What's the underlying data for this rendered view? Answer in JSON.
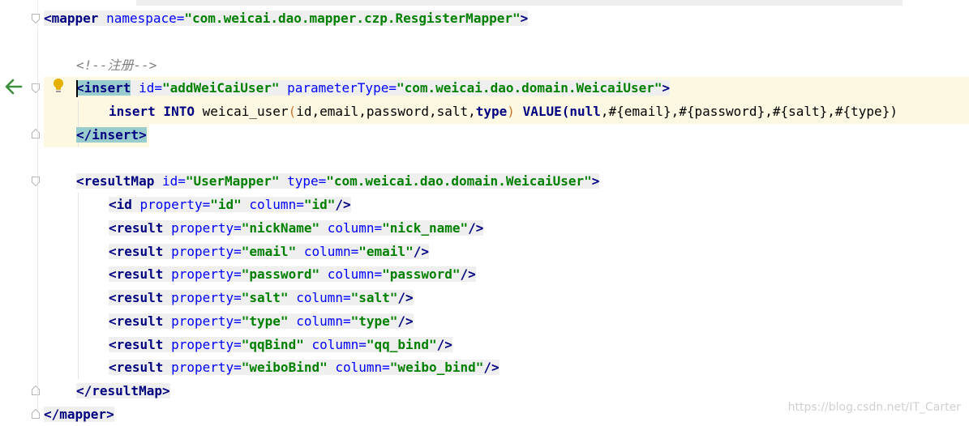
{
  "editor": {
    "lines": [
      {
        "id": "mapper_open",
        "text_parts": [
          {
            "t": "<mapper ",
            "c": "t"
          },
          {
            "t": "namespace=",
            "c": "a"
          },
          {
            "t": "\"",
            "c": "s"
          },
          {
            "t": "com.weicai.dao.mapper.czp.ResgisterMapper",
            "c": "s"
          },
          {
            "t": "\"",
            "c": "s"
          },
          {
            "t": ">",
            "c": "t"
          }
        ]
      },
      {
        "id": "comment",
        "text_parts": [
          {
            "t": "<!--注册-->",
            "c": "c"
          }
        ]
      },
      {
        "id": "insert_open",
        "text_parts": [
          {
            "t": "<insert",
            "c": "t match"
          },
          {
            "t": " id=",
            "c": "a"
          },
          {
            "t": "\"addWeiCaiUser\"",
            "c": "s"
          },
          {
            "t": " parameterType=",
            "c": "a"
          },
          {
            "t": "\"com.weicai.dao.domain.WeicaiUser\"",
            "c": "s"
          },
          {
            "t": ">",
            "c": "t"
          }
        ]
      },
      {
        "id": "insert_body",
        "text_parts": [
          {
            "t": "insert INTO ",
            "c": "kw"
          },
          {
            "t": "weicai_user",
            "c": "fn"
          },
          {
            "t": "(",
            "c": "paren"
          },
          {
            "t": "id,email,password,salt,",
            "c": "fn"
          },
          {
            "t": "type",
            "c": "kw"
          },
          {
            "t": ")",
            "c": "paren"
          },
          {
            "t": " VALUE(",
            "c": "kw"
          },
          {
            "t": "null",
            "c": "kw"
          },
          {
            "t": ",#{email},#{password},#{salt},#{type})",
            "c": "fn"
          }
        ]
      },
      {
        "id": "insert_close",
        "text_parts": [
          {
            "t": "</insert>",
            "c": "t match"
          }
        ]
      },
      {
        "id": "resultmap_open",
        "text_parts": [
          {
            "t": "<resultMap ",
            "c": "t"
          },
          {
            "t": "id=",
            "c": "a"
          },
          {
            "t": "\"UserMapper\"",
            "c": "s"
          },
          {
            "t": " type=",
            "c": "a"
          },
          {
            "t": "\"com.weicai.dao.domain.WeicaiUser\"",
            "c": "s"
          },
          {
            "t": ">",
            "c": "t"
          }
        ]
      },
      {
        "id": "rm_id",
        "text_parts": [
          {
            "t": "<id ",
            "c": "t"
          },
          {
            "t": "property=",
            "c": "a"
          },
          {
            "t": "\"id\"",
            "c": "s"
          },
          {
            "t": " column=",
            "c": "a"
          },
          {
            "t": "\"id\"",
            "c": "s"
          },
          {
            "t": "/>",
            "c": "t"
          }
        ]
      },
      {
        "id": "rm_nick",
        "text_parts": [
          {
            "t": "<result ",
            "c": "t"
          },
          {
            "t": "property=",
            "c": "a"
          },
          {
            "t": "\"nickName\"",
            "c": "s"
          },
          {
            "t": " column=",
            "c": "a"
          },
          {
            "t": "\"nick_name\"",
            "c": "s"
          },
          {
            "t": "/>",
            "c": "t"
          }
        ]
      },
      {
        "id": "rm_email",
        "text_parts": [
          {
            "t": "<result ",
            "c": "t"
          },
          {
            "t": "property=",
            "c": "a"
          },
          {
            "t": "\"email\"",
            "c": "s"
          },
          {
            "t": " column=",
            "c": "a"
          },
          {
            "t": "\"email\"",
            "c": "s"
          },
          {
            "t": "/>",
            "c": "t"
          }
        ]
      },
      {
        "id": "rm_password",
        "text_parts": [
          {
            "t": "<result ",
            "c": "t"
          },
          {
            "t": "property=",
            "c": "a"
          },
          {
            "t": "\"password\"",
            "c": "s"
          },
          {
            "t": " column=",
            "c": "a"
          },
          {
            "t": "\"password\"",
            "c": "s"
          },
          {
            "t": "/>",
            "c": "t"
          }
        ]
      },
      {
        "id": "rm_salt",
        "text_parts": [
          {
            "t": "<result ",
            "c": "t"
          },
          {
            "t": "property=",
            "c": "a"
          },
          {
            "t": "\"salt\"",
            "c": "s"
          },
          {
            "t": " column=",
            "c": "a"
          },
          {
            "t": "\"salt\"",
            "c": "s"
          },
          {
            "t": "/>",
            "c": "t"
          }
        ]
      },
      {
        "id": "rm_type",
        "text_parts": [
          {
            "t": "<result ",
            "c": "t"
          },
          {
            "t": "property=",
            "c": "a"
          },
          {
            "t": "\"type\"",
            "c": "s"
          },
          {
            "t": " column=",
            "c": "a"
          },
          {
            "t": "\"type\"",
            "c": "s"
          },
          {
            "t": "/>",
            "c": "t"
          }
        ]
      },
      {
        "id": "rm_qq",
        "text_parts": [
          {
            "t": "<result ",
            "c": "t"
          },
          {
            "t": "property=",
            "c": "a"
          },
          {
            "t": "\"qqBind\"",
            "c": "s"
          },
          {
            "t": " column=",
            "c": "a"
          },
          {
            "t": "\"qq_bind\"",
            "c": "s"
          },
          {
            "t": "/>",
            "c": "t"
          }
        ]
      },
      {
        "id": "rm_weibo",
        "text_parts": [
          {
            "t": "<result ",
            "c": "t"
          },
          {
            "t": "property=",
            "c": "a"
          },
          {
            "t": "\"weiboBind\"",
            "c": "s"
          },
          {
            "t": " column=",
            "c": "a"
          },
          {
            "t": "\"weibo_bind\"",
            "c": "s"
          },
          {
            "t": "/>",
            "c": "t"
          }
        ]
      },
      {
        "id": "resultmap_close",
        "text_parts": [
          {
            "t": "</resultMap>",
            "c": "t"
          }
        ]
      },
      {
        "id": "mapper_close",
        "text_parts": [
          {
            "t": "</mapper>",
            "c": "t"
          }
        ]
      }
    ]
  },
  "icons": {
    "navigate_back": "left-arrow-icon",
    "intention": "lightbulb-icon",
    "fold": "fold-marker-icon"
  },
  "colors": {
    "tag": "#000080",
    "attribute": "#0000ff",
    "string": "#008000",
    "comment": "#808080",
    "current_line": "#fcf8e1",
    "brace_match": "#99cccc",
    "arrow": "#3c8f3c",
    "bulb": "#e6b000"
  },
  "watermark": "https://blog.csdn.net/IT_Carter"
}
